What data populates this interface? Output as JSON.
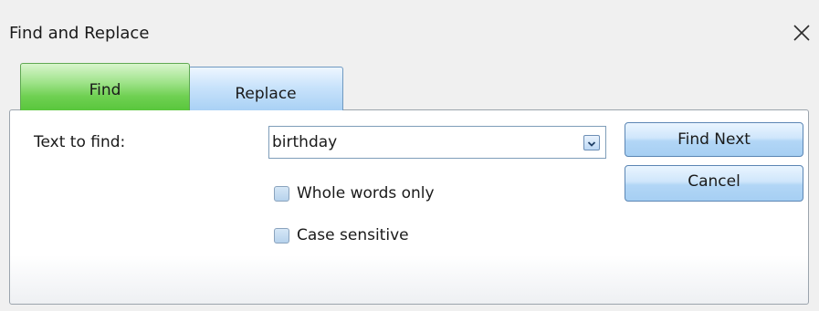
{
  "window": {
    "title": "Find and Replace",
    "close_icon": "close-icon"
  },
  "tabs": [
    {
      "label": "Find",
      "active": true
    },
    {
      "label": "Replace",
      "active": false
    }
  ],
  "find": {
    "label": "Text to find:",
    "value": "birthday",
    "dropdown_icon": "chevron-down-icon"
  },
  "options": {
    "whole_words": {
      "label": "Whole words only",
      "checked": false
    },
    "case_sensitive": {
      "label": "Case sensitive",
      "checked": false
    }
  },
  "buttons": {
    "find_next": "Find Next",
    "cancel": "Cancel"
  },
  "colors": {
    "active_tab": "#6fd052",
    "inactive_tab": "#a9d1f5",
    "button": "#b2d6f6"
  }
}
